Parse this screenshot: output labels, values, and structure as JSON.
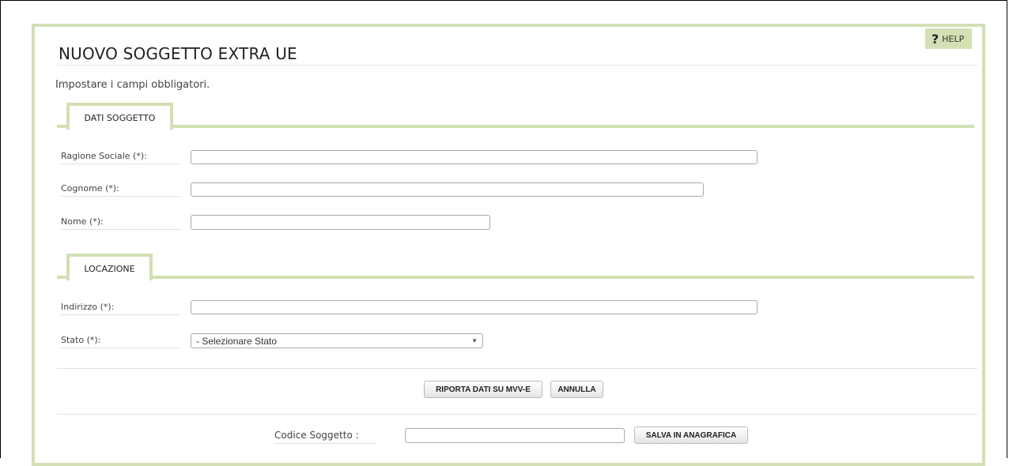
{
  "header": {
    "title": "NUOVO SOGGETTO EXTRA UE",
    "help_label": "HELP",
    "help_glyph": "?",
    "instructions": "Impostare i campi obbligatori."
  },
  "sections": {
    "dati_soggetto": {
      "label": "DATI SOGGETTO",
      "fields": {
        "ragione_sociale": {
          "label": "Ragione Sociale (*):",
          "value": ""
        },
        "cognome": {
          "label": "Cognome (*):",
          "value": ""
        },
        "nome": {
          "label": "Nome (*):",
          "value": ""
        }
      }
    },
    "locazione": {
      "label": "LOCAZIONE",
      "fields": {
        "indirizzo": {
          "label": "Indirizzo (*):",
          "value": ""
        },
        "stato": {
          "label": "Stato (*):",
          "selected": "- Selezionare Stato"
        }
      }
    }
  },
  "actions": {
    "riporta": "RIPORTA DATI SU MVV-E",
    "annulla": "ANNULLA"
  },
  "codice": {
    "label": "Codice Soggetto :",
    "value": "",
    "save": "SALVA IN ANAGRAFICA"
  },
  "colors": {
    "accent": "#d2e0b3"
  }
}
